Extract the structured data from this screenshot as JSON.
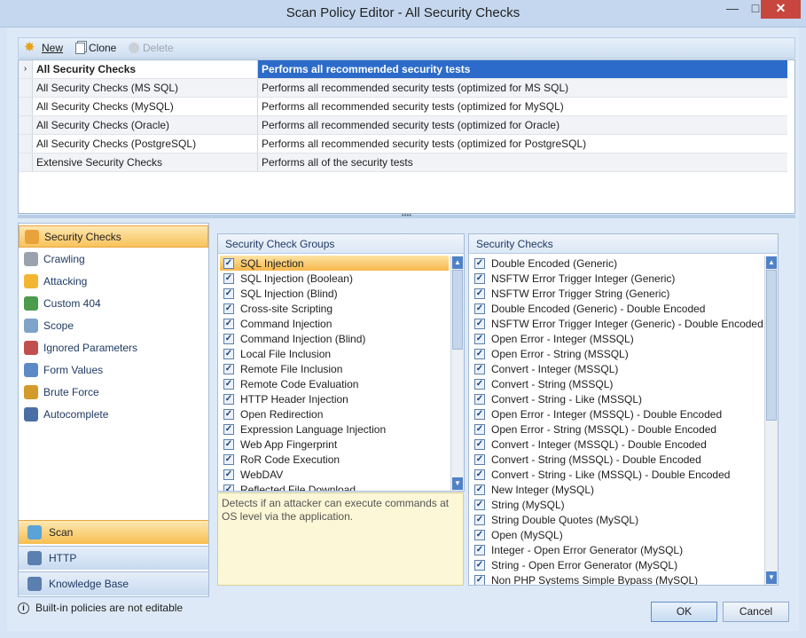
{
  "window": {
    "title": "Scan Policy Editor - All Security Checks",
    "min": "—",
    "max": "□",
    "close": "✕"
  },
  "toolbar": {
    "new_label": "New",
    "clone_label": "Clone",
    "delete_label": "Delete"
  },
  "policies": [
    {
      "name": "All Security Checks",
      "description": "Performs all recommended security tests",
      "selected": true
    },
    {
      "name": "All Security Checks (MS SQL)",
      "description": "Performs all recommended security tests (optimized for MS SQL)"
    },
    {
      "name": "All Security Checks (MySQL)",
      "description": "Performs all recommended security tests (optimized for MySQL)"
    },
    {
      "name": "All Security Checks (Oracle)",
      "description": "Performs all recommended security tests (optimized for Oracle)"
    },
    {
      "name": "All Security Checks (PostgreSQL)",
      "description": "Performs all recommended security tests (optimized for PostgreSQL)"
    },
    {
      "name": "Extensive Security Checks",
      "description": "Performs all of the security tests"
    }
  ],
  "splitter_grip": "••••",
  "nav": {
    "items": [
      {
        "label": "Security Checks",
        "icon": "globe-check-icon",
        "color": "#e9a23b"
      },
      {
        "label": "Crawling",
        "icon": "crawler-icon",
        "color": "#9aa3ad"
      },
      {
        "label": "Attacking",
        "icon": "lightning-icon",
        "color": "#f2b632"
      },
      {
        "label": "Custom 404",
        "icon": "globe-icon",
        "color": "#4c9a4c"
      },
      {
        "label": "Scope",
        "icon": "scope-icon",
        "color": "#7fa3c9"
      },
      {
        "label": "Ignored Parameters",
        "icon": "ignored-params-icon",
        "color": "#c0504d"
      },
      {
        "label": "Form Values",
        "icon": "form-icon",
        "color": "#5b8ac6"
      },
      {
        "label": "Brute Force",
        "icon": "lock-icon",
        "color": "#d39b2c"
      },
      {
        "label": "Autocomplete",
        "icon": "autocomplete-icon",
        "color": "#4a6fa5"
      }
    ],
    "bottom": [
      {
        "label": "Scan",
        "icon": "scan-cube-icon",
        "active": true
      },
      {
        "label": "HTTP",
        "icon": "http-globe-icon"
      },
      {
        "label": "Knowledge Base",
        "icon": "book-icon"
      }
    ]
  },
  "groups_panel": {
    "title": "Security Check Groups",
    "items": [
      "SQL Injection",
      "SQL Injection (Boolean)",
      "SQL Injection (Blind)",
      "Cross-site Scripting",
      "Command Injection",
      "Command Injection (Blind)",
      "Local File Inclusion",
      "Remote File Inclusion",
      "Remote Code Evaluation",
      "HTTP Header Injection",
      "Open Redirection",
      "Expression Language Injection",
      "Web App Fingerprint",
      "RoR Code Execution",
      "WebDAV",
      "Reflected File Download"
    ],
    "description": "Detects if an attacker can execute commands at OS level via the application."
  },
  "checks_panel": {
    "title": "Security Checks",
    "items": [
      "Double Encoded (Generic)",
      "NSFTW Error Trigger Integer (Generic)",
      "NSFTW  Error Trigger String (Generic)",
      "Double Encoded (Generic) - Double Encoded",
      "NSFTW Error Trigger Integer (Generic) - Double Encoded",
      "Open Error - Integer (MSSQL)",
      "Open Error - String (MSSQL)",
      "Convert - Integer (MSSQL)",
      "Convert - String (MSSQL)",
      "Convert - String - Like (MSSQL)",
      "Open Error - Integer (MSSQL) - Double Encoded",
      "Open Error - String (MSSQL) - Double Encoded",
      "Convert - Integer (MSSQL) - Double Encoded",
      "Convert - String (MSSQL) - Double Encoded",
      "Convert - String - Like (MSSQL) - Double Encoded",
      "New Integer (MySQL)",
      "String (MySQL)",
      "String Double Quotes (MySQL)",
      "Open (MySQL)",
      "Integer - Open Error Generator (MySQL)",
      "String - Open Error Generator (MySQL)",
      "Non PHP Systems Simple Bypass (MySQL)"
    ]
  },
  "status": {
    "text": "Built-in policies are not editable",
    "icon": "info-icon"
  },
  "buttons": {
    "ok": "OK",
    "cancel": "Cancel"
  },
  "checkmark": "✓",
  "colors": {
    "selection": "#2c6bc9",
    "accent_orange": "#f7b84a"
  }
}
